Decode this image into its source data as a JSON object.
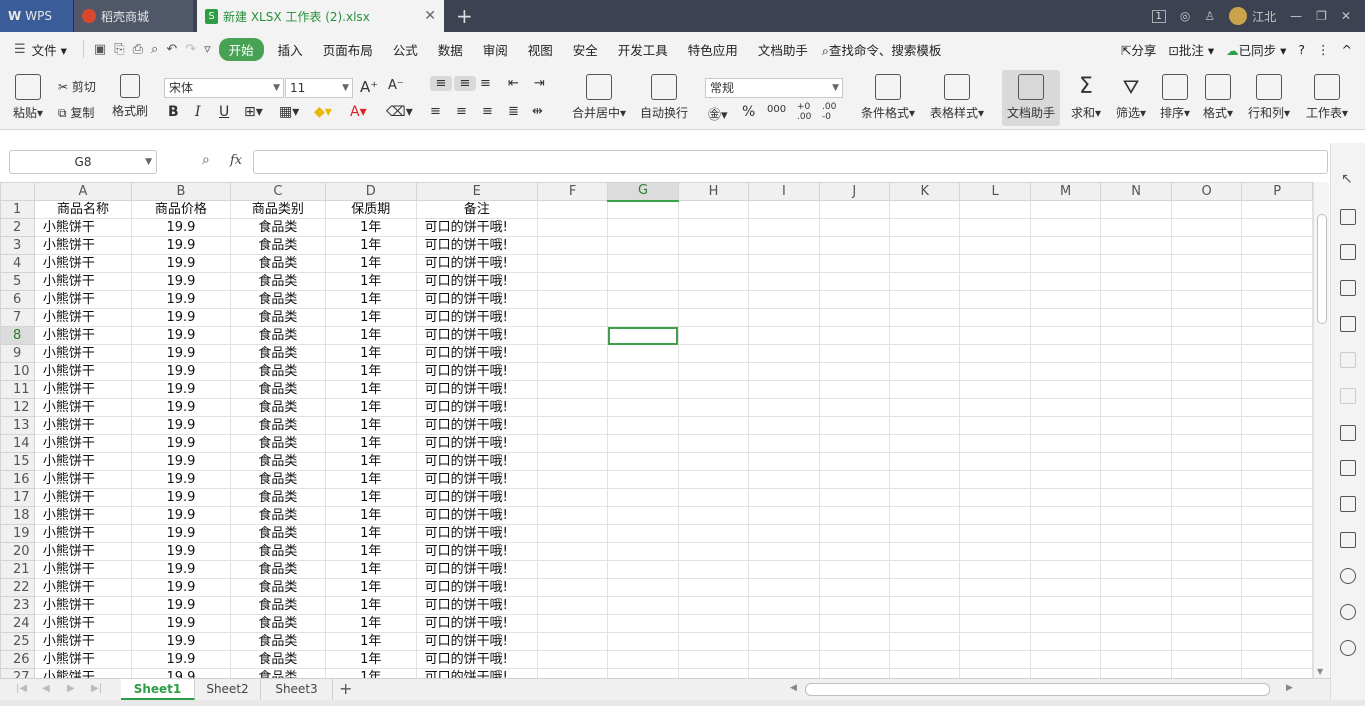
{
  "titlebar": {
    "wps_label": "WPS",
    "store_label": "稻壳商城",
    "doc_title": "新建 XLSX 工作表 (2).xlsx",
    "badge_num": "1",
    "user_name": "江北"
  },
  "menu": {
    "file_label": "文件",
    "items": [
      "开始",
      "插入",
      "页面布局",
      "公式",
      "数据",
      "审阅",
      "视图",
      "安全",
      "开发工具",
      "特色应用",
      "文档助手"
    ],
    "search_label": "查找命令、搜索模板",
    "share_label": "分享",
    "comment_label": "批注",
    "sync_label": "已同步",
    "help_label": "?"
  },
  "ribbon": {
    "paste": "粘贴",
    "cut": "剪切",
    "copy": "复制",
    "format_painter": "格式刷",
    "font_name": "宋体",
    "font_size": "11",
    "merge_center": "合并居中",
    "wrap_text": "自动换行",
    "number_format": "常规",
    "cond_format": "条件格式",
    "table_style": "表格样式",
    "doc_assistant": "文档助手",
    "sum": "求和",
    "filter": "筛选",
    "sort": "排序",
    "format": "格式",
    "row_col": "行和列",
    "worksheet": "工作表"
  },
  "formula": {
    "name_box": "G8",
    "fx_label": "fx",
    "formula_value": ""
  },
  "grid": {
    "columns": [
      "A",
      "B",
      "C",
      "D",
      "E",
      "F",
      "G",
      "H",
      "I",
      "J",
      "K",
      "L",
      "M",
      "N",
      "O",
      "P"
    ],
    "active_column": "G",
    "active_row": 8,
    "header_row": [
      "商品名称",
      "商品价格",
      "商品类别",
      "保质期",
      "备注"
    ],
    "data_row": [
      "小熊饼干",
      "19.9",
      "食品类",
      "1年",
      "可口的饼干哦!"
    ],
    "row_count": 27
  },
  "sheets": {
    "tabs": [
      "Sheet1",
      "Sheet2",
      "Sheet3"
    ],
    "active": "Sheet1",
    "add_label": "+"
  }
}
